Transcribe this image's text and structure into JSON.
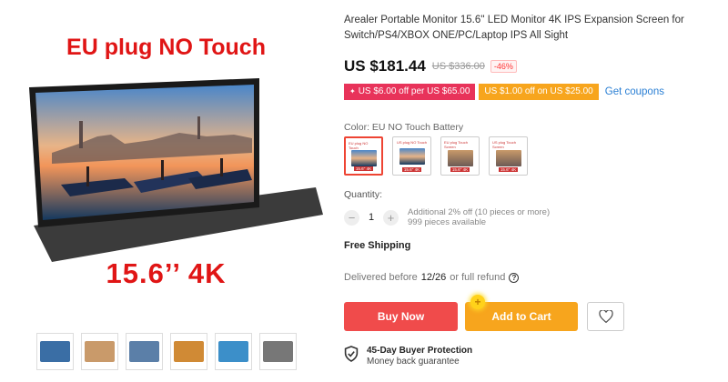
{
  "gallery": {
    "hero_title": "EU plug NO Touch",
    "hero_subtitle": "15.6’’ 4K",
    "thumbnails": [
      {
        "name": "thumb-1",
        "tone": "#3a6ea5"
      },
      {
        "name": "thumb-2",
        "tone": "#c99a6a"
      },
      {
        "name": "thumb-3",
        "tone": "#5b7fa8"
      },
      {
        "name": "thumb-4",
        "tone": "#d08a35"
      },
      {
        "name": "thumb-5",
        "tone": "#3c8fc9"
      },
      {
        "name": "thumb-6",
        "tone": "#777777"
      }
    ]
  },
  "product": {
    "title": "Arealer Portable Monitor 15.6'' LED Monitor 4K IPS Expansion Screen for Switch/PS4/XBOX ONE/PC/Laptop IPS All Sight",
    "price": "US $181.44",
    "original_price": "US $336.00",
    "discount": "-46%",
    "coupon_primary": "US $6.00 off per US $65.00",
    "coupon_secondary": "US $1.00 off on US $25.00",
    "get_coupons": "Get coupons",
    "color_label": "Color: EU NO Touch Battery",
    "swatches": [
      {
        "top": "EU plug NO Touch",
        "bottom": "15.6'' 4K",
        "selected": true
      },
      {
        "top": "US plug NO Touch",
        "bottom": "15.6'' 4K",
        "selected": false
      },
      {
        "top": "EU plug Touch Screen",
        "bottom": "15.6'' 4K",
        "selected": false
      },
      {
        "top": "US plug Touch Screen",
        "bottom": "15.6'' 4K",
        "selected": false
      }
    ],
    "quantity_label": "Quantity:",
    "quantity_value": "1",
    "quantity_minus": "−",
    "quantity_plus": "+",
    "bulk_note": "Additional 2% off (10 pieces or more)",
    "available": "999 pieces available",
    "free_shipping": "Free Shipping",
    "delivery_prefix": "Delivered before",
    "delivery_date": "12/26",
    "delivery_suffix": "or full refund",
    "buy_now": "Buy Now",
    "add_to_cart": "Add to Cart",
    "protection_title": "45-Day Buyer Protection",
    "protection_sub": "Money back guarantee"
  },
  "colors": {
    "accent_red": "#f04b4b",
    "accent_orange": "#f7a51d",
    "coupon_pink": "#e8335a",
    "link_blue": "#2a7fd4"
  }
}
